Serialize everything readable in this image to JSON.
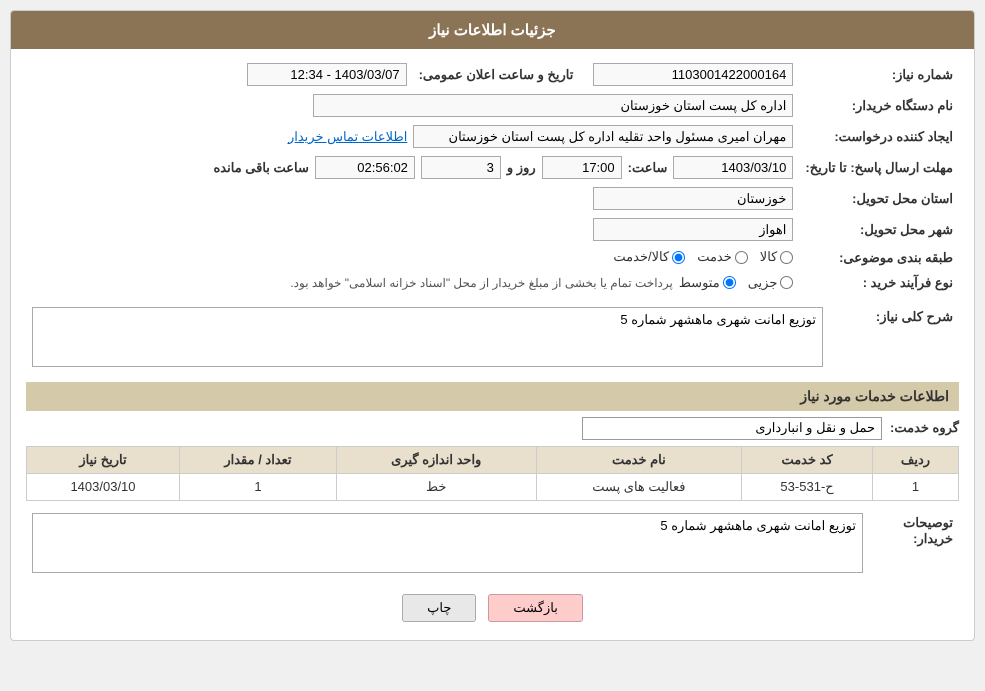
{
  "header": {
    "title": "جزئیات اطلاعات نیاز"
  },
  "fields": {
    "need_number_label": "شماره نیاز:",
    "need_number_value": "1103001422000164",
    "announcement_date_label": "تاریخ و ساعت اعلان عمومی:",
    "announcement_date_value": "1403/03/07 - 12:34",
    "buyer_org_label": "نام دستگاه خریدار:",
    "buyer_org_value": "اداره کل پست استان خوزستان",
    "requester_label": "ایجاد کننده درخواست:",
    "requester_value": "مهران امیری مسئول واحد تقلیه اداره کل پست استان خوزستان",
    "requester_link": "اطلاعات تماس خریدار",
    "deadline_label": "مهلت ارسال پاسخ: تا تاریخ:",
    "deadline_date": "1403/03/10",
    "deadline_time_label": "ساعت:",
    "deadline_time": "17:00",
    "deadline_days_label": "روز و",
    "deadline_days": "3",
    "deadline_remaining_label": "ساعت باقی مانده",
    "deadline_remaining": "02:56:02",
    "province_label": "استان محل تحویل:",
    "province_value": "خوزستان",
    "city_label": "شهر محل تحویل:",
    "city_value": "اهواز",
    "category_label": "طبقه بندی موضوعی:",
    "category_options": [
      "کالا",
      "خدمت",
      "کالا/خدمت"
    ],
    "category_selected": "کالا",
    "proc_type_label": "نوع فرآیند خرید :",
    "proc_type_options": [
      "جزیی",
      "متوسط"
    ],
    "proc_type_selected": "متوسط",
    "proc_note": "پرداخت تمام یا بخشی از مبلغ خریدار از محل \"اسناد خزانه اسلامی\" خواهد بود.",
    "description_label": "شرح کلی نیاز:",
    "description_value": "توزیع امانت شهری ماهشهر شماره 5",
    "services_header": "اطلاعات خدمات مورد نیاز",
    "service_group_label": "گروه خدمت:",
    "service_group_value": "حمل و نقل و انبارداری",
    "table_headers": [
      "ردیف",
      "کد خدمت",
      "نام خدمت",
      "واحد اندازه گیری",
      "تعداد / مقدار",
      "تاریخ نیاز"
    ],
    "table_rows": [
      {
        "row": "1",
        "code": "ح-531-53",
        "name": "فعالیت های پست",
        "unit": "خط",
        "qty": "1",
        "date": "1403/03/10"
      }
    ],
    "buyer_desc_label": "توصیحات خریدار:",
    "buyer_desc_value": "توزیع امانت شهری ماهشهر شماره 5"
  },
  "buttons": {
    "print": "چاپ",
    "back": "بازگشت"
  }
}
